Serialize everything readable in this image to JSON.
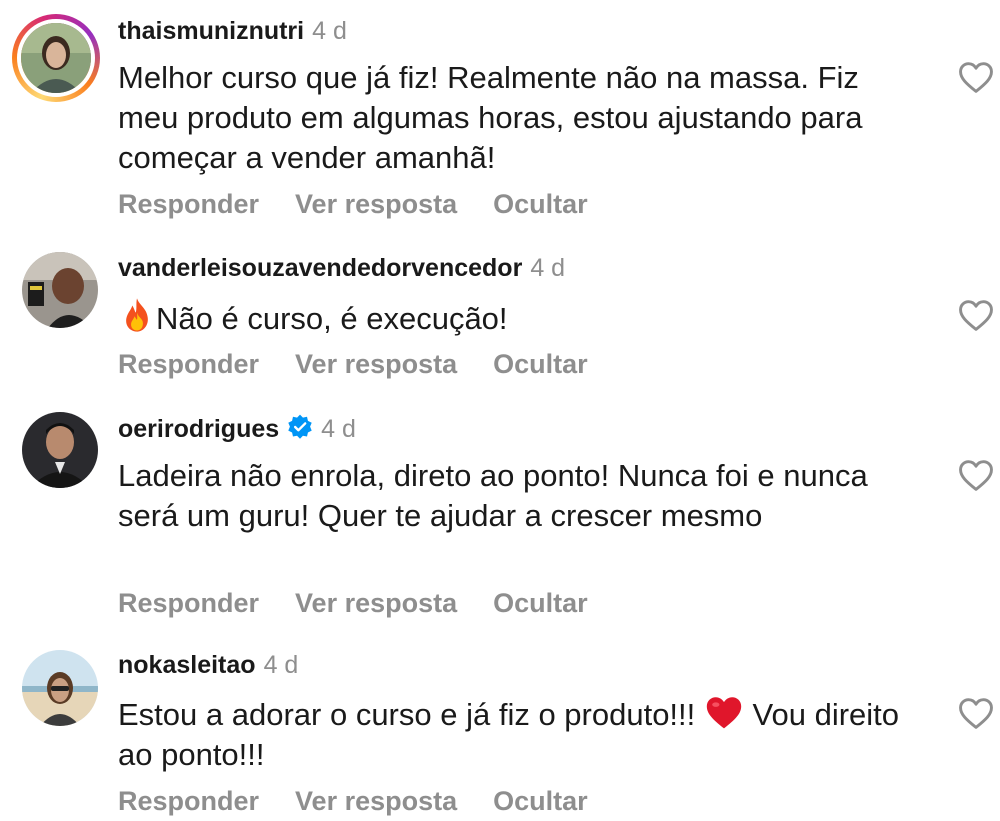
{
  "comments": [
    {
      "username": "thaismuniznutri",
      "time": "4 d",
      "text": "Melhor curso que já fiz! Realmente não na massa. Fiz meu produto em algumas horas, estou ajustando para começar a vender amanhã!",
      "reply_label": "Responder",
      "view_reply_label": "Ver resposta",
      "hide_label": "Ocultar"
    },
    {
      "username": "vanderleisouzavendedorvencedor",
      "time": "4 d",
      "text": "Não é curso, é execução!",
      "emoji_icon": "fire-emoji",
      "reply_label": "Responder",
      "view_reply_label": "Ver resposta",
      "hide_label": "Ocultar"
    },
    {
      "username": "oerirodrigues",
      "verified": true,
      "time": "4 d",
      "text": "Ladeira não enrola, direto ao ponto! Nunca foi e nunca será um guru! Quer te ajudar a crescer mesmo",
      "reply_label": "Responder",
      "view_reply_label": "Ver resposta",
      "hide_label": "Ocultar"
    },
    {
      "username": "nokasleitao",
      "time": "4 d",
      "text_before_emoji": "Estou a adorar o curso e já fiz o produto!!!",
      "emoji_icon": "red-heart-emoji",
      "text_after_emoji": "Vou direito ao ponto!!!",
      "reply_label": "Responder",
      "view_reply_label": "Ver resposta",
      "hide_label": "Ocultar"
    }
  ],
  "colors": {
    "text": "#1a1a1a",
    "muted": "#8e8e8e",
    "verified": "#0095f6",
    "heart_outline": "#8e8e8e"
  }
}
